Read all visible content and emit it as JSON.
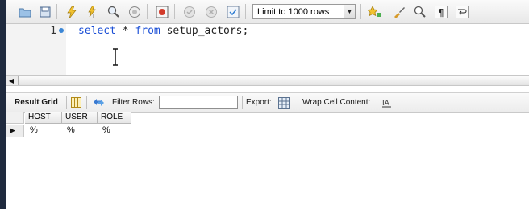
{
  "toolbar": {
    "icons": [
      "folder-icon",
      "save-icon",
      "execute-icon",
      "execute-current-icon",
      "explain-icon",
      "stop-icon",
      "toggle-error-icon",
      "commit-icon",
      "rollback-icon",
      "autocommit-icon",
      "beautify-icon",
      "find-icon",
      "invisibles-icon",
      "wrap-icon"
    ],
    "limit_select": "Limit to 1000 rows"
  },
  "editor": {
    "line_number": "1",
    "code_keyword_select": "select",
    "code_star": " * ",
    "code_keyword_from": "from",
    "code_table": " setup_actors;"
  },
  "result_toolbar": {
    "result_grid_label": "Result Grid",
    "filter_rows_label": "Filter Rows:",
    "filter_rows_value": "",
    "export_label": "Export:",
    "wrap_label": "Wrap Cell Content:"
  },
  "grid": {
    "columns": [
      "HOST",
      "USER",
      "ROLE"
    ],
    "rows": [
      [
        "%",
        "%",
        "%"
      ]
    ]
  },
  "colors": {
    "keyword": "#1b4fd6",
    "frame": "#1f2a3e",
    "line_dot": "#3b86d6"
  }
}
